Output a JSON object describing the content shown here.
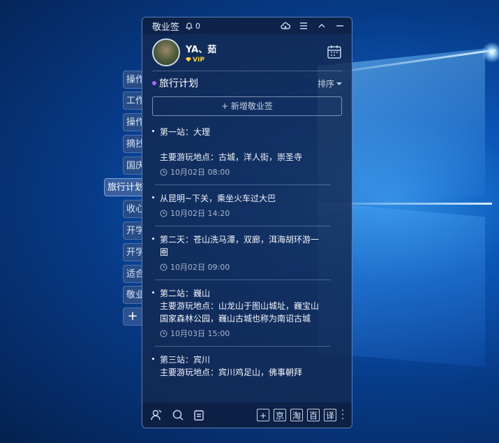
{
  "app": {
    "title": "敬业签",
    "bell_count": "0"
  },
  "user": {
    "name": "YA、茹",
    "badge": "VIP"
  },
  "side_tabs": [
    "操作",
    "工作",
    "操作",
    "摘抄",
    "国庆",
    "旅行计划",
    "收心",
    "开学",
    "开学",
    "适合",
    "敬业"
  ],
  "notebook": {
    "title": "旅行计划",
    "sort_label": "排序",
    "new_note_label": "+ 新增敬业签"
  },
  "notes": [
    {
      "title": "第一站：大理",
      "body": [
        "",
        "主要游玩地点：古城，洋人街，崇圣寺"
      ],
      "time": "10月02日  08:00"
    },
    {
      "title": "从昆明~下关，乘坐火车过大巴",
      "body": [],
      "time": "10月02日  14:20"
    },
    {
      "title": "第二天：苍山洗马潭，双廊，洱海胡环游一",
      "body": [
        "圈"
      ],
      "time": "10月02日  09:00"
    },
    {
      "title": "第二站：巍山",
      "body": [
        "主要游玩地点：山龙山于图山城址，巍宝山",
        "国家森林公园，巍山古城也称为南诏古城"
      ],
      "time": "10月03日  15:00"
    },
    {
      "title": "第三站：宾川",
      "body": [
        "主要游玩地点：宾川鸡足山，佛事朝拜"
      ],
      "time": ""
    }
  ],
  "toolbar": {
    "buttons": [
      "+",
      "京",
      "淘",
      "百",
      "译"
    ]
  },
  "colors": {
    "accent_dot": "#b162ff",
    "vip": "#f5d23c"
  }
}
